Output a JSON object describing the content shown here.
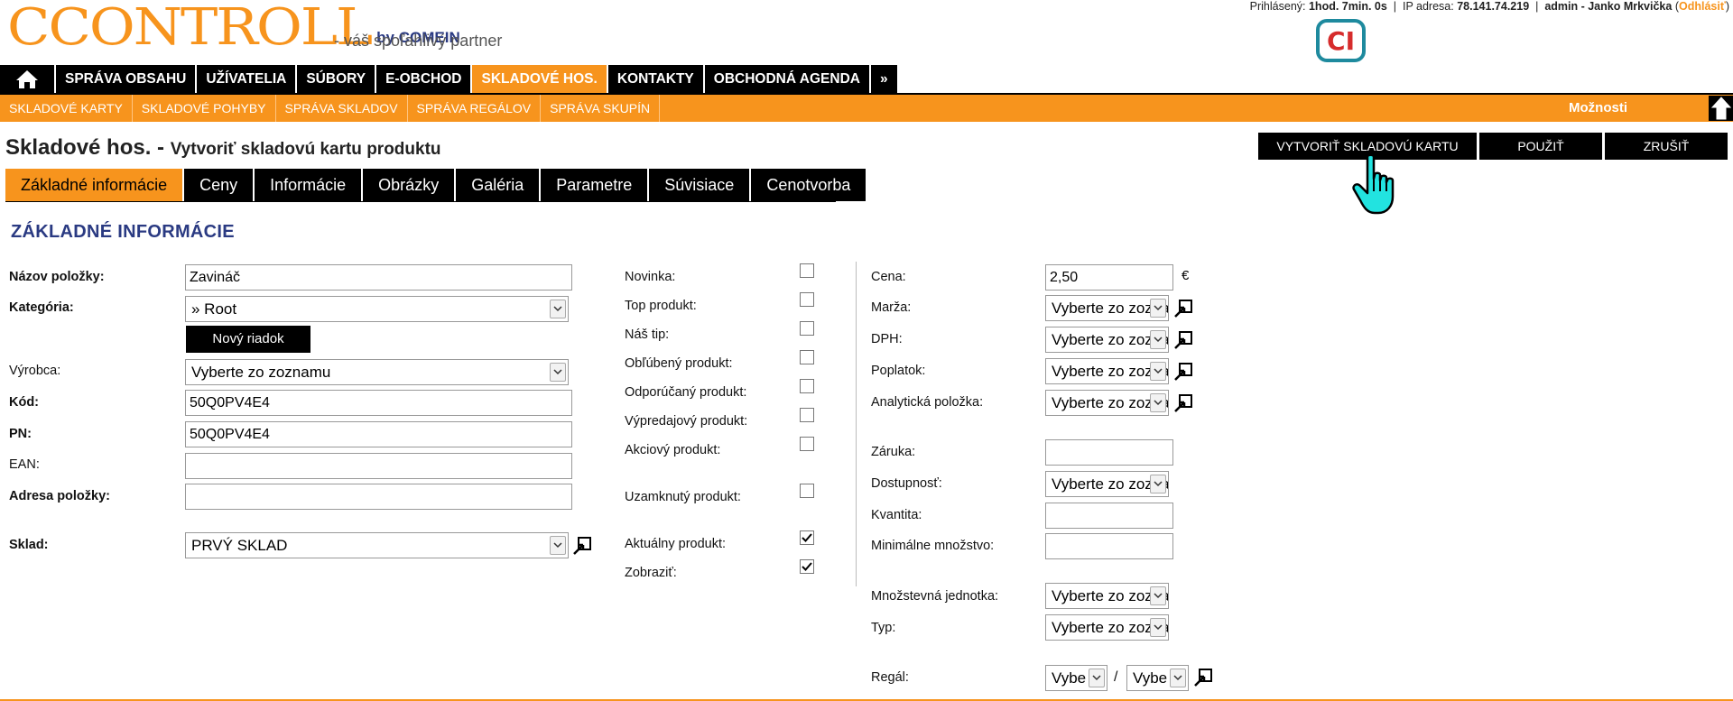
{
  "header": {
    "logo_text": "CCONTROLL",
    "logo_by": "by COMEIN",
    "tagline": "- váš spoľahlivý partner",
    "user_prefix": "Prihlásený:",
    "session_time": "1hod. 7min. 0s",
    "ip_label": "IP adresa:",
    "ip": "78.141.74.219",
    "user": "admin - Janko Mrkvička",
    "logout": "Odhlásiť",
    "ci_logo": "CI"
  },
  "mainnav": {
    "items": [
      "SPRÁVA OBSAHU",
      "UŽÍVATELIA",
      "SÚBORY",
      "E-OBCHOD",
      "SKLADOVÉ HOS.",
      "KONTAKTY",
      "OBCHODNÁ AGENDA",
      "»"
    ]
  },
  "subnav": {
    "items": [
      "SKLADOVÉ KARTY",
      "SKLADOVÉ POHYBY",
      "SPRÁVA SKLADOV",
      "SPRÁVA REGÁLOV",
      "SPRÁVA SKUPÍN"
    ],
    "options": "Možnosti"
  },
  "page": {
    "title": "Skladové hos.",
    "subtitle": "Vytvoriť skladovú kartu produktu"
  },
  "actions": {
    "create": "VYTVORIŤ SKLADOVÚ KARTU",
    "apply": "POUŽIŤ",
    "cancel": "ZRUŠIŤ"
  },
  "tabs": [
    "Základné informácie",
    "Ceny",
    "Informácie",
    "Obrázky",
    "Galéria",
    "Parametre",
    "Súvisiace",
    "Cenotvorba"
  ],
  "section_title": "ZÁKLADNÉ INFORMÁCIE",
  "left": {
    "nazov_label": "Názov položky:",
    "nazov_value": "Zavináč",
    "kategoria_label": "Kategória:",
    "kategoria_value": "» Root",
    "novy_riadok": "Nový riadok",
    "vyrobca_label": "Výrobca:",
    "vyrobca_value": "Vyberte zo zoznamu",
    "kod_label": "Kód:",
    "kod_value": "50Q0PV4E4",
    "pn_label": "PN:",
    "pn_value": "50Q0PV4E4",
    "ean_label": "EAN:",
    "ean_value": "",
    "adresa_label": "Adresa položky:",
    "adresa_value": "",
    "sklad_label": "Sklad:",
    "sklad_value": "PRVÝ SKLAD"
  },
  "middle": {
    "novinka": "Novinka:",
    "top": "Top produkt:",
    "nas_tip": "Náš tip:",
    "oblubeny": "Obľúbený produkt:",
    "odporucany": "Odporúčaný produkt:",
    "vypredajovy": "Výpredajový produkt:",
    "akciovy": "Akciový produkt:",
    "uzamknuty": "Uzamknutý produkt:",
    "aktualny": "Aktuálny produkt:",
    "zobrazit": "Zobraziť:"
  },
  "right": {
    "cena_label": "Cena:",
    "cena_value": "2,50",
    "currency": "€",
    "marza_label": "Marža:",
    "dph_label": "DPH:",
    "poplatok_label": "Poplatok:",
    "analyticka_label": "Analytická položka:",
    "zaruka_label": "Záruka:",
    "dostupnost_label": "Dostupnosť:",
    "kvantita_label": "Kvantita:",
    "min_label": "Minimálne množstvo:",
    "jednotka_label": "Množstevná jednotka:",
    "typ_label": "Typ:",
    "regal_label": "Regál:",
    "select_placeholder": "Vyberte zo zoznamu",
    "regal_short": "Vybe",
    "regal_sep": "/"
  },
  "colors": {
    "accent": "#f7941d",
    "nav": "#000000",
    "heading": "#2a3a82"
  }
}
